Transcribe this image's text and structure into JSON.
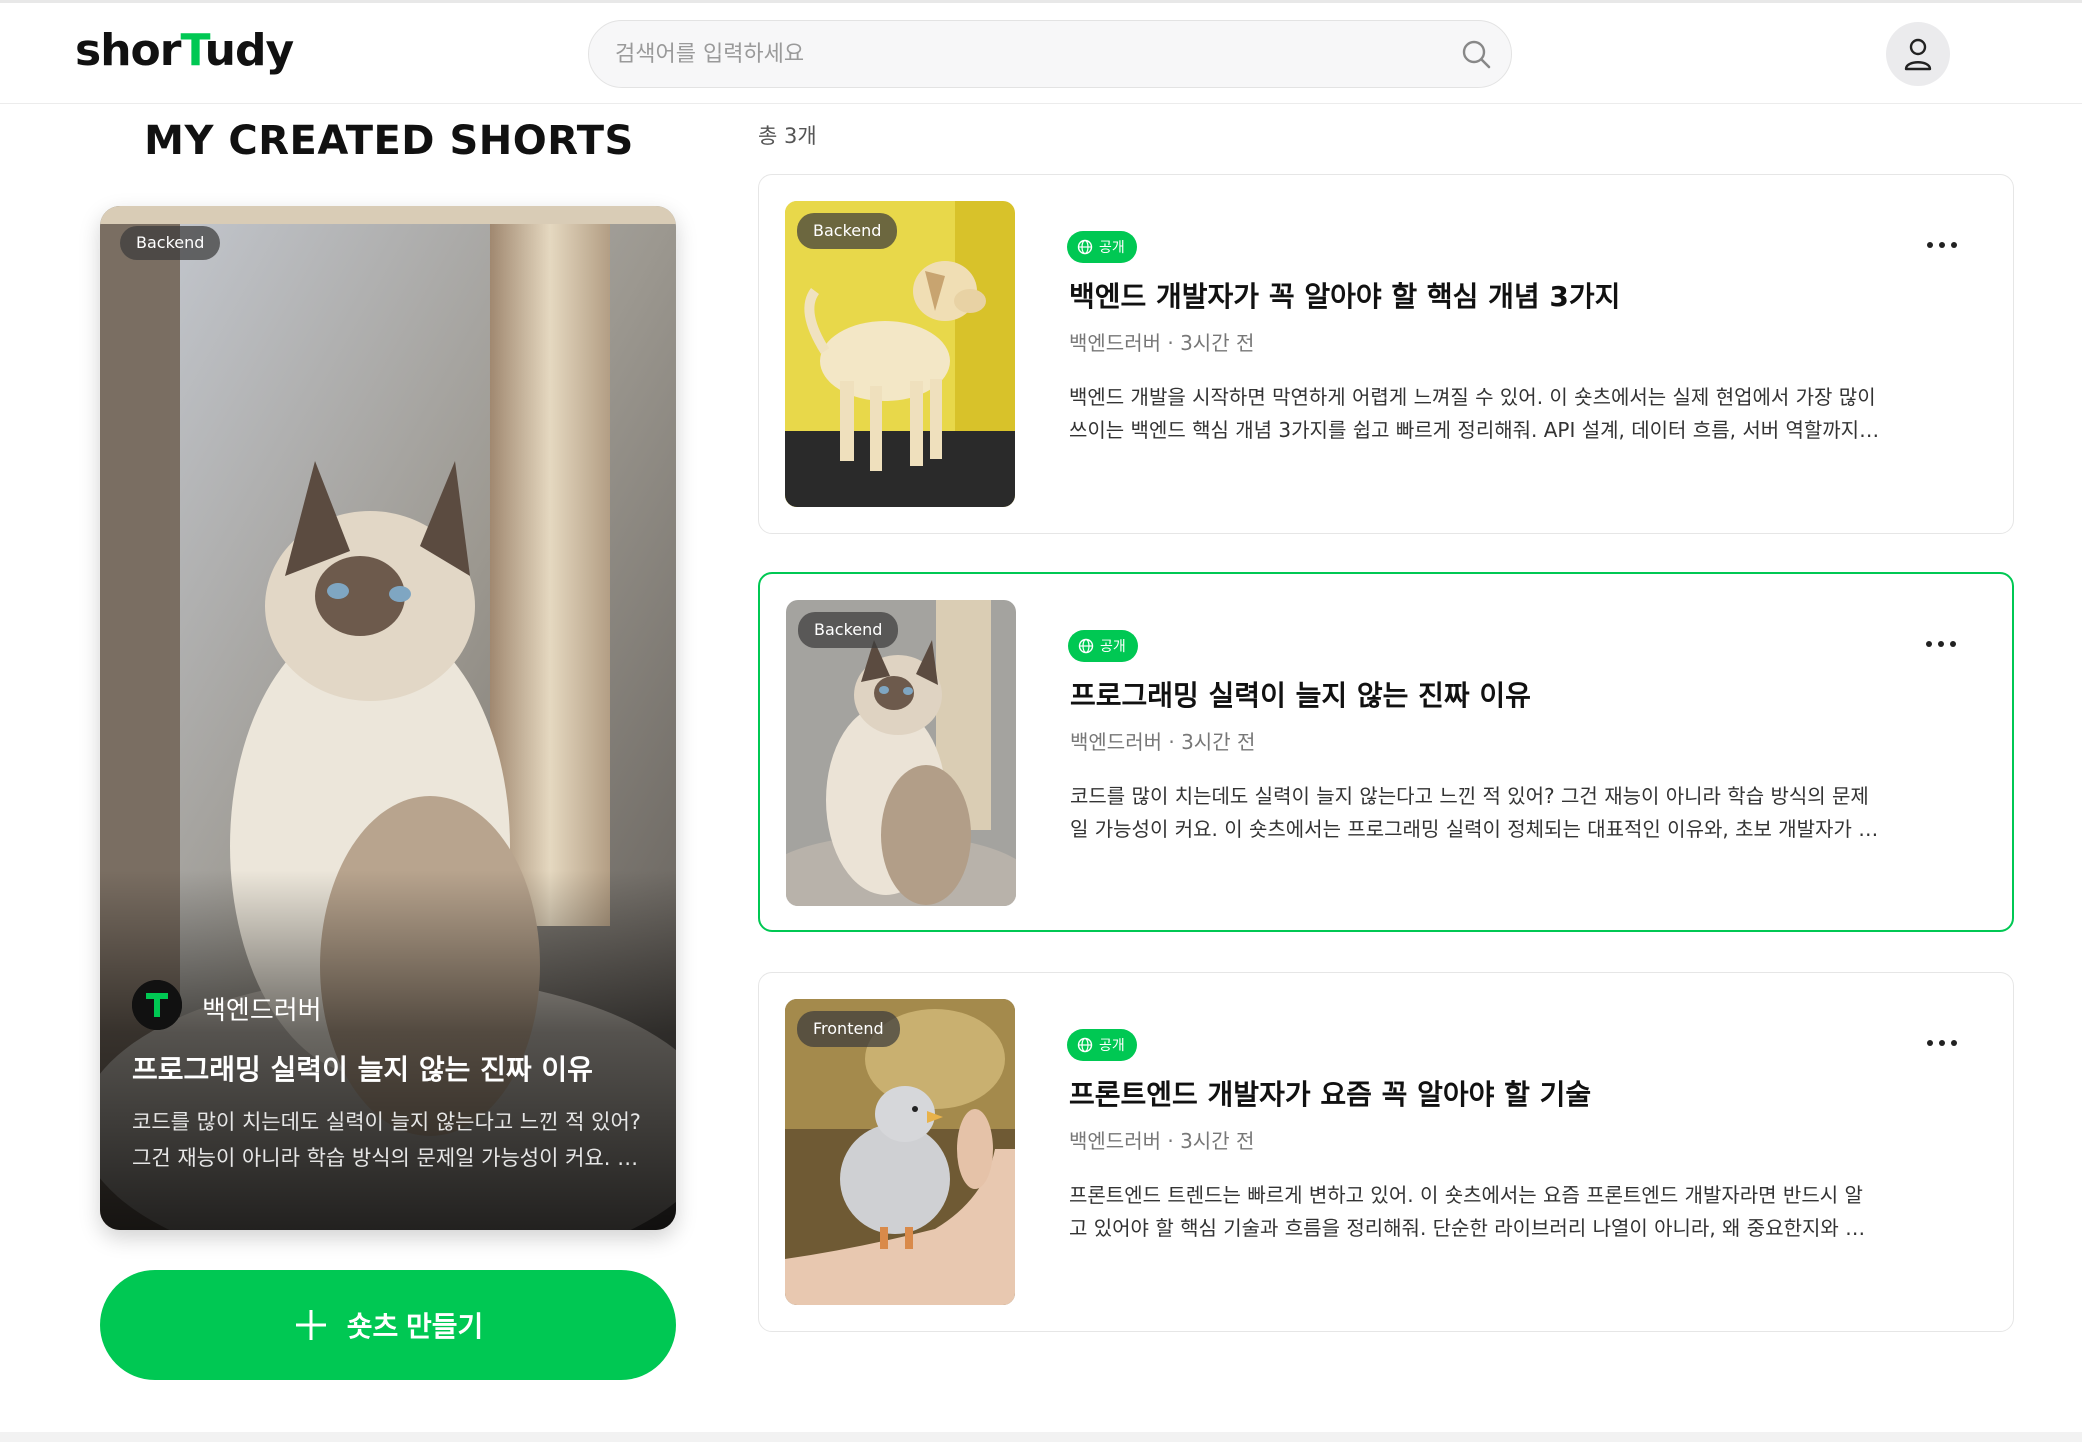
{
  "brand": {
    "logo_prefix": "shor",
    "logo_accent": "T",
    "logo_suffix": "udy",
    "accent_color": "#00c853"
  },
  "search": {
    "placeholder": "검색어를 입력하세요",
    "value": "",
    "icon": "search-icon"
  },
  "profile": {
    "icon": "user-icon"
  },
  "page_title": "MY CREATED SHORTS",
  "featured": {
    "category": "Backend",
    "author": "백엔드러버",
    "author_logo_letter": "T",
    "title": "프로그래밍 실력이 늘지 않는 진짜 이유",
    "description_line1": "코드를 많이 치는데도 실력이 늘지 않는다고 느낀 적 있어?",
    "description_line2": "그건 재능이 아니라 학습 방식의 문제일 가능성이 커요. …",
    "image": "cat-photo"
  },
  "create_button": {
    "label": "숏츠 만들기",
    "icon": "plus-icon"
  },
  "list": {
    "total": "총 3개",
    "items": [
      {
        "category": "Backend",
        "visibility": "공개",
        "title": "백엔드 개발자가 꼭 알아야 할 핵심 개념 3가지",
        "meta": "백엔드러버 · 3시간 전",
        "description_line1": "백엔드 개발을 시작하면 막연하게 어렵게 느껴질 수 있어. 이 숏츠에서는 실제 현업에서 가장 많이",
        "description_line2": "쓰이는 백엔드 핵심 개념 3가지를 쉽고 빠르게 정리해줘. API 설계, 데이터 흐름, 서버 역할까지…",
        "image": "dog-photo",
        "selected": false
      },
      {
        "category": "Backend",
        "visibility": "공개",
        "title": "프로그래밍 실력이 늘지 않는 진짜 이유",
        "meta": "백엔드러버 · 3시간 전",
        "description_line1": "코드를 많이 치는데도 실력이 늘지 않는다고 느낀 적 있어? 그건 재능이 아니라 학습 방식의 문제",
        "description_line2": "일 가능성이 커요. 이 숏츠에서는 프로그래밍 실력이 정체되는 대표적인 이유와, 초보 개발자가 …",
        "image": "cat-photo",
        "selected": true
      },
      {
        "category": "Frontend",
        "visibility": "공개",
        "title": "프론트엔드 개발자가 요즘 꼭 알아야 할 기술",
        "meta": "백엔드러버 · 3시간 전",
        "description_line1": "프론트엔드 트렌드는 빠르게 변하고 있어. 이 숏츠에서는 요즘 프론트엔드 개발자라면 반드시 알",
        "description_line2": "고 있어야 할 핵심 기술과 흐름을 정리해줘. 단순한 라이브러리 나열이 아니라, 왜 중요한지와 …",
        "image": "chick-photo",
        "selected": false
      }
    ]
  }
}
